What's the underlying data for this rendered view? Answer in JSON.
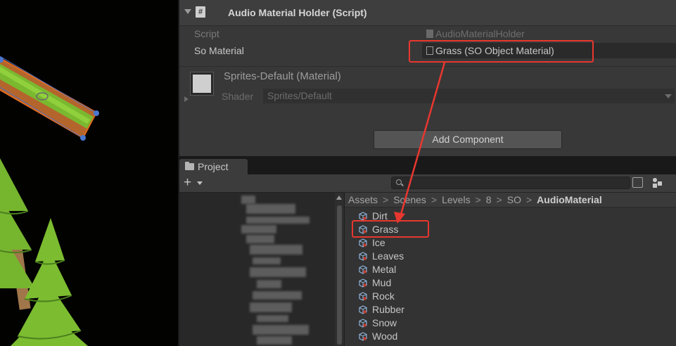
{
  "inspector": {
    "component_title": "Audio Material Holder (Script)",
    "properties": [
      {
        "label": "Script",
        "value": "AudioMaterialHolder"
      },
      {
        "label": "So Material",
        "value": "Grass (SO Object Material)"
      }
    ],
    "material": {
      "name": "Sprites-Default (Material)",
      "shader_label": "Shader",
      "shader_value": "Sprites/Default"
    },
    "add_component_label": "Add Component"
  },
  "project": {
    "tab_label": "Project",
    "add_label": "+",
    "breadcrumb": [
      "Assets",
      "Scenes",
      "Levels",
      "8",
      "SO",
      "AudioMaterial"
    ],
    "assets": [
      "Dirt",
      "Grass",
      "Ice",
      "Leaves",
      "Metal",
      "Mud",
      "Rock",
      "Rubber",
      "Snow",
      "Wood"
    ]
  },
  "annotation": {
    "highlight_color": "#e8372f",
    "highlighted_items": [
      "Grass (SO Object Material)",
      "Grass"
    ]
  },
  "colors": {
    "inspector_bg": "#383838",
    "project_bg": "#333333",
    "grass_green": "#7ab830",
    "tree_green": "#76b52e",
    "trunk": "#a0764a",
    "selection_orange": "#e06a1e"
  }
}
